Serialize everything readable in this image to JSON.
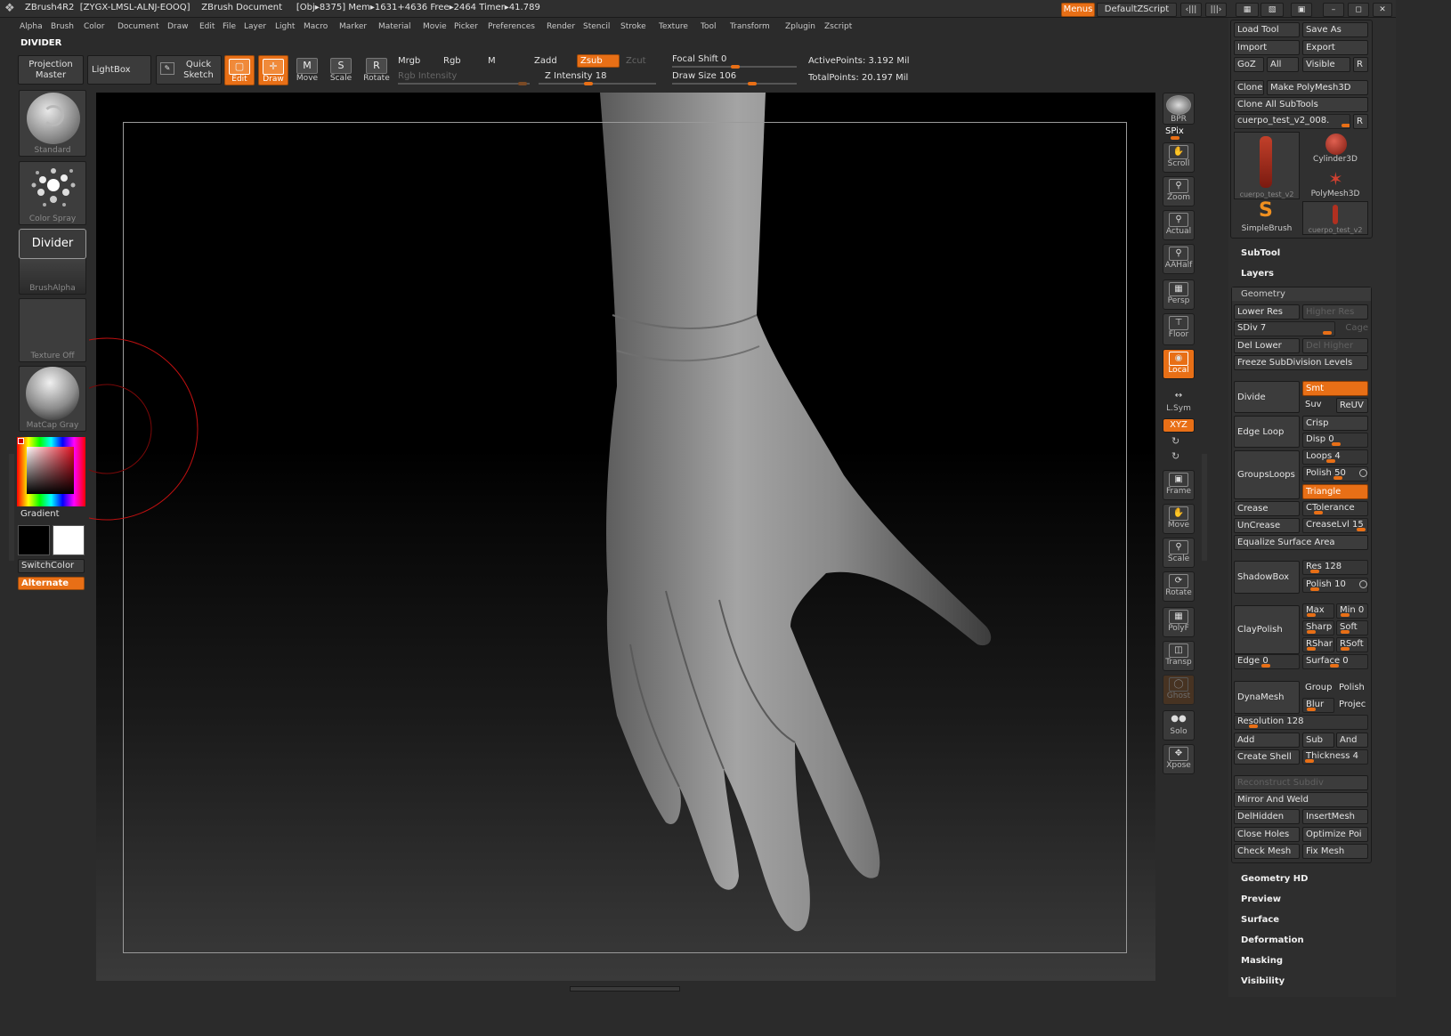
{
  "title_bar": {
    "app": "ZBrush4R2",
    "serial": "[ZYGX-LMSL-ALNJ-EOOQ]",
    "document": "ZBrush Document",
    "stats": "[Obj▸8375]  Mem▸1631+4636  Free▸2464  Timer▸41.789",
    "menus_label": "Menus",
    "script_label": "DefaultZScript"
  },
  "menu": [
    "Alpha",
    "Brush",
    "Color",
    "Document",
    "Draw",
    "Edit",
    "File",
    "Layer",
    "Light",
    "Macro",
    "Marker",
    "Material",
    "Movie",
    "Picker",
    "Preferences",
    "Render",
    "Stencil",
    "Stroke",
    "Texture",
    "Tool",
    "Transform",
    "Zplugin",
    "Zscript"
  ],
  "status_label": "DIVIDER",
  "shelf": {
    "projection_master": [
      "Projection",
      "Master"
    ],
    "lightbox": "LightBox",
    "quick_sketch": [
      "Quick",
      "Sketch"
    ],
    "edit": "Edit",
    "draw": "Draw",
    "move": "Move",
    "scale": "Scale",
    "rotate": "Rotate",
    "mrgb": "Mrgb",
    "rgb": "Rgb",
    "m": "M",
    "zadd": "Zadd",
    "zsub": "Zsub",
    "zcut": "Zcut",
    "rgb_intensity": "Rgb Intensity",
    "z_intensity": "Z Intensity 18",
    "focal_shift": "Focal Shift 0",
    "draw_size": "Draw Size 106",
    "active_points": "ActivePoints: 3.192  Mil",
    "total_points": "TotalPoints: 20.197  Mil"
  },
  "left_panel": {
    "brush": "Standard",
    "stroke": "Color  Spray",
    "alpha_tooltip": "Divider",
    "alpha": "BrushAlpha",
    "texture": "Texture  Off",
    "material": "MatCap  Gray",
    "gradient": "Gradient",
    "switch_color": "SwitchColor",
    "alternate": "Alternate",
    "main_color": "#000000",
    "secondary_color": "#ffffff"
  },
  "right_toolbar": [
    {
      "label": "BPR",
      "name": "bpr"
    },
    {
      "label": "SPix",
      "name": "spix"
    },
    {
      "label": "Scroll",
      "name": "scroll"
    },
    {
      "label": "Zoom",
      "name": "zoom"
    },
    {
      "label": "Actual",
      "name": "actual"
    },
    {
      "label": "AAHalf",
      "name": "aahalf"
    },
    {
      "label": "Persp",
      "name": "persp"
    },
    {
      "label": "Floor",
      "name": "floor"
    },
    {
      "label": "Local",
      "name": "local"
    },
    {
      "label": "L.Sym",
      "name": "lsym"
    },
    {
      "label": "XYZ",
      "name": "xyz"
    },
    {
      "label": "Frame",
      "name": "frame"
    },
    {
      "label": "Move",
      "name": "move"
    },
    {
      "label": "Scale",
      "name": "scale"
    },
    {
      "label": "Rotate",
      "name": "rotate"
    },
    {
      "label": "PolyF",
      "name": "polyf"
    },
    {
      "label": "Transp",
      "name": "transp"
    },
    {
      "label": "Ghost",
      "name": "ghost"
    },
    {
      "label": "Solo",
      "name": "solo"
    },
    {
      "label": "Xpose",
      "name": "xpose"
    }
  ],
  "tool_panel": {
    "load_tool": "Load Tool",
    "save_as": "Save As",
    "import": "Import",
    "export": "Export",
    "goz": "GoZ",
    "all": "All",
    "visible": "Visible",
    "r": "R",
    "clone": "Clone",
    "make_polymesh": "Make PolyMesh3D",
    "clone_all": "Clone  All  SubTools",
    "current_tool": "cuerpo_test_v2_008.",
    "thumbs": [
      "cuerpo_test_v2",
      "Cylinder3D",
      "PolyMesh3D",
      "SimpleBrush",
      "cuerpo_test_v2"
    ],
    "subtool": "SubTool",
    "layers": "Layers",
    "geometry": "Geometry",
    "lower_res": "Lower Res",
    "higher_res": "Higher Res",
    "sdiv": "SDiv 7",
    "cage": "Cage",
    "del_lower": "Del Lower",
    "del_higher": "Del Higher",
    "freeze": "Freeze  SubDivision  Levels",
    "divide": "Divide",
    "smt": "Smt",
    "suv": "Suv",
    "reuv": "ReUV",
    "edge_loop": "Edge  Loop",
    "crisp": "Crisp",
    "disp": "Disp 0",
    "groups_loops": "GroupsLoops",
    "loops": "Loops 4",
    "polish50": "Polish 50",
    "triangle": "Triangle",
    "crease": "Crease",
    "ctolerance": "CTolerance",
    "uncrease": "UnCrease",
    "creaselvl": "CreaseLvl 15",
    "equalize": "Equalize  Surface  Area",
    "shadowbox": "ShadowBox",
    "res": "Res 128",
    "polish10": "Polish 10",
    "claypolish": "ClayPolish",
    "max": "Max",
    "min": "Min 0",
    "sharp": "Sharp",
    "soft": "Soft",
    "rshar": "RShar",
    "rsoft": "RSoft",
    "edge": "Edge 0",
    "surface0": "Surface 0",
    "dynamesh": "DynaMesh",
    "group": "Group",
    "polish": "Polish",
    "blur": "Blur",
    "project": "Projec",
    "resolution": "Resolution 128",
    "add": "Add",
    "sub": "Sub",
    "and": "And",
    "create_shell": "Create  Shell",
    "thickness": "Thickness 4",
    "reconstruct": "Reconstruct  Subdiv",
    "mirror_weld": "Mirror  And  Weld",
    "delhidden": "DelHidden",
    "insertmesh": "InsertMesh",
    "close_holes": "Close  Holes",
    "optimize": "Optimize  Poi",
    "check_mesh": "Check  Mesh",
    "fix_mesh": "Fix  Mesh",
    "sections": [
      "Geometry HD",
      "Preview",
      "Surface",
      "Deformation",
      "Masking",
      "Visibility"
    ]
  },
  "colors": {
    "accent": "#e86f16",
    "panel": "#2e2e2e",
    "viewport": "#000000"
  }
}
